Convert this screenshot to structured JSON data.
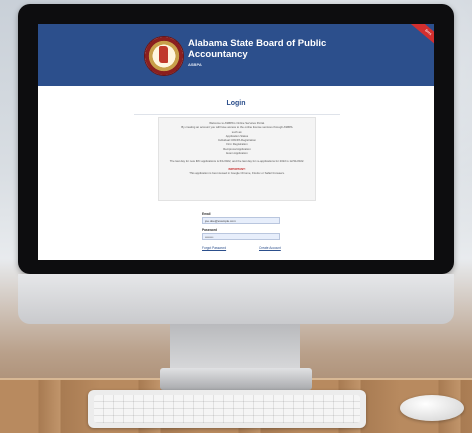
{
  "header": {
    "title": "Alabama State Board of Public Accountancy",
    "abbreviation": "ASBPA",
    "ribbon": "Beta"
  },
  "page": {
    "title": "Login"
  },
  "notice": {
    "lines": [
      "Welcome to ASBPA's Online Services Portal.",
      "By creating an account you will have access to the online license services through ASBPA",
      "such as:",
      "Application Status",
      "Individual CPA/PA Registration",
      "Firm Registration",
      "Reciprocal Application",
      "Exam Application"
    ],
    "deadline": "The last day for new IRC applications is 6/1/2022, and the last day for re-applications for 2022 is 12/31/2022.",
    "important_label": "IMPORTANT:",
    "important_text": "This application is best viewed in Google Chrome, Firefox or Safari browsers."
  },
  "form": {
    "email_label": "Email",
    "email_value": "joe.doe@example.com",
    "password_label": "Password",
    "password_value": "••••••••",
    "forgot_password": "Forgot Password",
    "create_account": "Create Account"
  }
}
